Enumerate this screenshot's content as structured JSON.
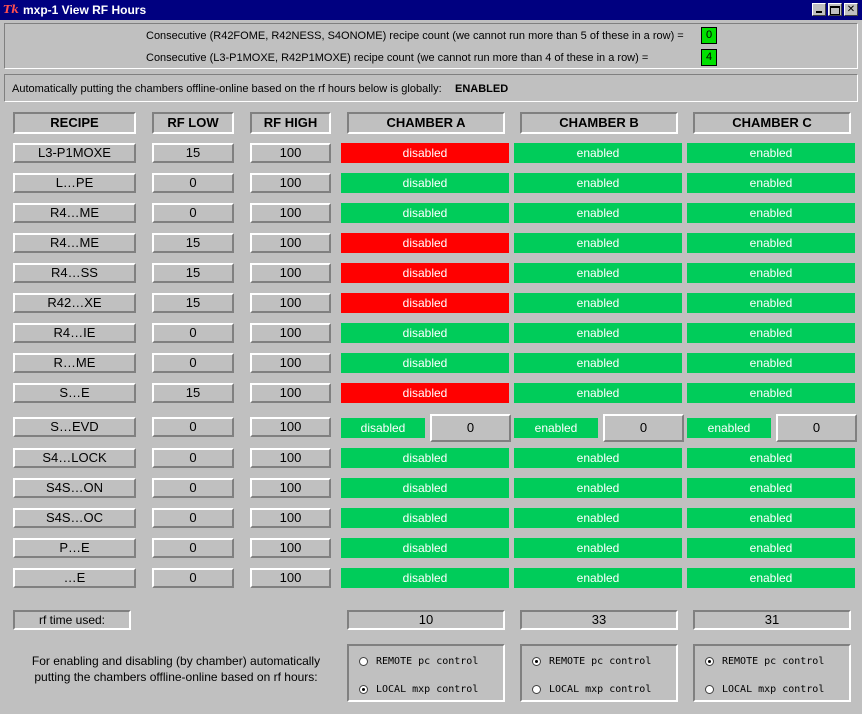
{
  "window": {
    "title": "mxp-1 View RF Hours",
    "icon": "Tk"
  },
  "consecutive": [
    {
      "label": "Consecutive   (R42FOME, R42NESS, S4ONOME)   recipe count   (we cannot run more than 5 of these in a row) =",
      "count": "0"
    },
    {
      "label": "Consecutive   (L3-P1MOXE, R42P1MOXE)   recipe count   (we cannot run more than 4 of these in a row) =",
      "count": "4"
    }
  ],
  "global": {
    "text": "Automatically putting the chambers offline-online based on the rf hours below is globally:",
    "value": "ENABLED"
  },
  "headers": {
    "recipe": "RECIPE",
    "rf_low": "RF LOW",
    "rf_high": "RF HIGH",
    "a": "CHAMBER A",
    "b": "CHAMBER B",
    "c": "CHAMBER C"
  },
  "colors": {
    "enabled": "#00cc5a",
    "disabled_red": "#ff0000"
  },
  "rows": [
    {
      "recipe": "L3-P1MOXE",
      "low": "15",
      "high": "100",
      "a": "disabled",
      "a_color": "red",
      "b": "enabled",
      "c": "enabled"
    },
    {
      "recipe": "L…PE",
      "low": "0",
      "high": "100",
      "a": "disabled",
      "a_color": "green",
      "b": "enabled",
      "c": "enabled"
    },
    {
      "recipe": "R4…ME",
      "low": "0",
      "high": "100",
      "a": "disabled",
      "a_color": "green",
      "b": "enabled",
      "c": "enabled"
    },
    {
      "recipe": "R4…ME",
      "low": "15",
      "high": "100",
      "a": "disabled",
      "a_color": "red",
      "b": "enabled",
      "c": "enabled"
    },
    {
      "recipe": "R4…SS",
      "low": "15",
      "high": "100",
      "a": "disabled",
      "a_color": "red",
      "b": "enabled",
      "c": "enabled"
    },
    {
      "recipe": "R42…XE",
      "low": "15",
      "high": "100",
      "a": "disabled",
      "a_color": "red",
      "b": "enabled",
      "c": "enabled"
    },
    {
      "recipe": "R4…IE",
      "low": "0",
      "high": "100",
      "a": "disabled",
      "a_color": "green",
      "b": "enabled",
      "c": "enabled"
    },
    {
      "recipe": "R…ME",
      "low": "0",
      "high": "100",
      "a": "disabled",
      "a_color": "green",
      "b": "enabled",
      "c": "enabled"
    },
    {
      "recipe": "S…E",
      "low": "15",
      "high": "100",
      "a": "disabled",
      "a_color": "red",
      "b": "enabled",
      "c": "enabled"
    },
    {
      "recipe": "S…EVD",
      "low": "0",
      "high": "100",
      "a": "disabled",
      "a_color": "green",
      "b": "enabled",
      "c": "enabled",
      "special": true,
      "a_num": "0",
      "b_num": "0",
      "c_num": "0"
    },
    {
      "recipe": "S4…LOCK",
      "low": "0",
      "high": "100",
      "a": "disabled",
      "a_color": "green",
      "b": "enabled",
      "c": "enabled"
    },
    {
      "recipe": "S4S…ON",
      "low": "0",
      "high": "100",
      "a": "disabled",
      "a_color": "green",
      "b": "enabled",
      "c": "enabled"
    },
    {
      "recipe": "S4S…OC",
      "low": "0",
      "high": "100",
      "a": "disabled",
      "a_color": "green",
      "b": "enabled",
      "c": "enabled"
    },
    {
      "recipe": "P…E",
      "low": "0",
      "high": "100",
      "a": "disabled",
      "a_color": "green",
      "b": "enabled",
      "c": "enabled"
    },
    {
      "recipe": "…E",
      "low": "0",
      "high": "100",
      "a": "disabled",
      "a_color": "green",
      "b": "enabled",
      "c": "enabled"
    }
  ],
  "rf_used": {
    "label": "rf time used:",
    "a": "10",
    "b": "33",
    "c": "31"
  },
  "footer": {
    "text": "For enabling and disabling (by chamber) automatically putting the chambers offline-online based on rf hours:",
    "remote_label": "REMOTE pc control",
    "local_label": "LOCAL mxp control",
    "a_selected": "local",
    "b_selected": "remote",
    "c_selected": "remote"
  }
}
